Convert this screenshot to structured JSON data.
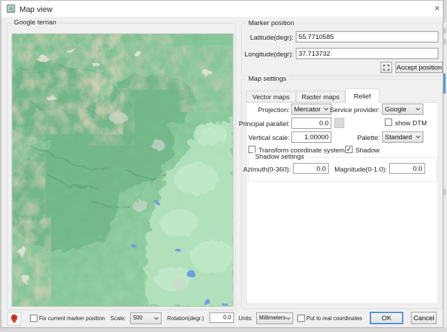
{
  "window": {
    "title": "Map view"
  },
  "icons": {
    "close": "×",
    "check": "✓",
    "crosshair": "focus-corners",
    "marker_pin": "red-map-pin",
    "chevron": "chevron-down"
  },
  "colors": {
    "ok_focus_border": "#2f7bd3",
    "marker_pin": "#e23b2e",
    "map_green": "#8bcf9d",
    "map_lowland": "#b3e2bd",
    "map_ridge_tan": "#c6ab8f",
    "lake_blue": "#6f9ce4"
  },
  "left_panel": {
    "group_label": "Google terrian"
  },
  "marker_position": {
    "group_label": "Marker position",
    "latitude_label": "Latitude(degr):",
    "latitude_value": "55.7710585",
    "longitude_label": "Longitude(degr):",
    "longitude_value": "37.713732",
    "accept_button_label": "Accept position"
  },
  "map_settings": {
    "group_label": "Map settings",
    "tabs": [
      {
        "label": "Vector maps",
        "active": false
      },
      {
        "label": "Raster maps",
        "active": false
      },
      {
        "label": "Relief",
        "active": true
      }
    ],
    "relief": {
      "projection_label": "Projection:",
      "projection_value": "Mercator",
      "service_provider_label": "Service provider:",
      "service_provider_value": "Google",
      "principal_parallel_label": "Principal parallel:",
      "principal_parallel_value": "0.0",
      "show_dtm_label": "show DTM",
      "show_dtm_checked": false,
      "vertical_scale_label": "Vertical scale:",
      "vertical_scale_value": "1.00000",
      "palette_label": "Palette:",
      "palette_value": "Standard",
      "transform_label": "Transform coordinate system",
      "transform_checked": false,
      "shadow_label": "Shadow",
      "shadow_checked": true,
      "shadow_settings": {
        "group_label": "Shadow settings",
        "azimuth_label": "Azimuth(0-360):",
        "azimuth_value": "0.0",
        "magnitude_label": "Magnitude(0-1.0):",
        "magnitude_value": "0.0"
      }
    }
  },
  "bottom_bar": {
    "fix_marker_label": "Fix current marker position",
    "fix_marker_checked": false,
    "scale_label": "Scale:",
    "scale_value": "500",
    "rotation_label": "Rotation(degr.)",
    "rotation_value": "0.0",
    "units_label": "Units:",
    "units_value": "Millimeters",
    "put_real_label": "Put to real coordinates",
    "put_real_checked": false,
    "ok_label": "OK",
    "cancel_label": "Cancel"
  }
}
